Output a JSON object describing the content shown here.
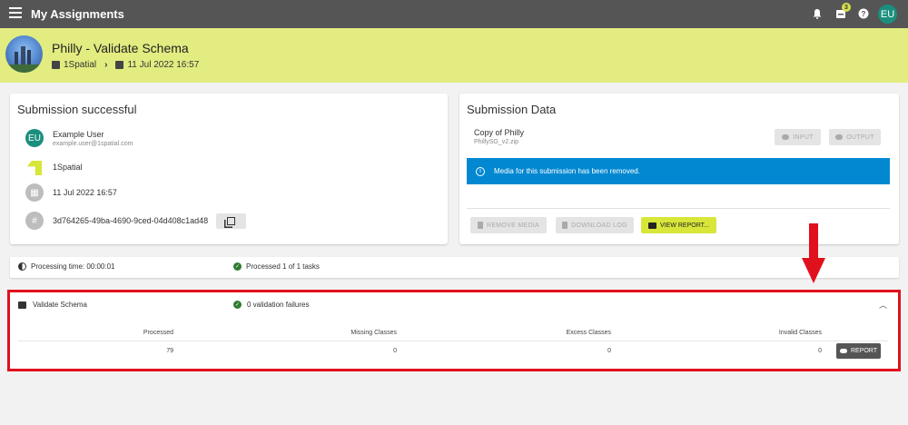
{
  "topbar": {
    "title": "My Assignments",
    "inbox_count": "3",
    "avatar": "EU"
  },
  "header": {
    "title": "Philly - Validate Schema",
    "org": "1Spatial",
    "date": "11 Jul 2022 16:57"
  },
  "submission": {
    "heading": "Submission successful",
    "user_name": "Example User",
    "user_email": "example.user@1spatial.com",
    "user_initials": "EU",
    "org": "1Spatial",
    "date": "11 Jul 2022 16:57",
    "hash_symbol": "#",
    "id": "3d764265-49ba-4690-9ced-04d408c1ad48"
  },
  "submission_data": {
    "heading": "Submission Data",
    "copy_title": "Copy of Philly",
    "file": "PhillySG_v2.zip",
    "input_label": "INPUT",
    "output_label": "OUTPUT",
    "info_message": "Media for this submission has been removed.",
    "remove_media_label": "REMOVE MEDIA",
    "download_log_label": "DOWNLOAD LOG",
    "view_report_label": "VIEW REPORT..."
  },
  "processing": {
    "time": "Processing time: 00:00:01",
    "status": "Processed 1 of 1 tasks"
  },
  "validation": {
    "title": "Validate Schema",
    "failures": "0 validation failures",
    "columns": [
      "Processed",
      "Missing Classes",
      "Excess Classes",
      "Invalid Classes"
    ],
    "values": [
      "79",
      "0",
      "0",
      "0"
    ],
    "report_label": "REPORT"
  },
  "colors": {
    "accent": "#d8e63a",
    "header_bg": "#e2ec80",
    "info": "#0288d1",
    "highlight": "#e0101d"
  }
}
